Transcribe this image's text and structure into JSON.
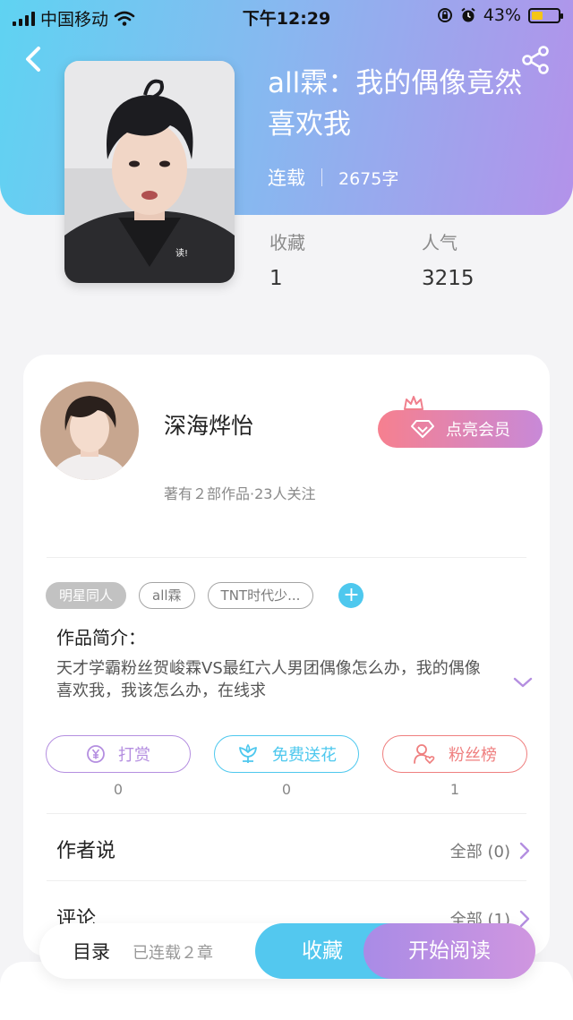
{
  "status_bar": {
    "carrier": "中国移动",
    "time": "下午12:29",
    "battery_text": "43%",
    "battery_level": 0.43
  },
  "colors": {
    "accent_blue": "#53c8ef",
    "accent_purple": "#b392ea",
    "vip_pink": "#f6808f",
    "reward_purple": "#b48ee0",
    "flower_blue": "#4ec8ee",
    "fans_red": "#ef7f7f"
  },
  "book": {
    "title": "all霖：我的偶像竟然喜欢我",
    "status": "连载",
    "word_count": "2675字",
    "stats": [
      {
        "label": "收藏",
        "value": "1"
      },
      {
        "label": "人气",
        "value": "3215"
      }
    ]
  },
  "author": {
    "name": "深海烨怡",
    "subline": "著有２部作品·23人关注",
    "vip_label": "点亮会员"
  },
  "tags": [
    "明星同人",
    "all霖",
    "TNT时代少..."
  ],
  "intro": {
    "heading": "作品简介：",
    "text": "天才学霸粉丝贺峻霖VS最红六人男团偶像怎么办，我的偶像喜欢我，我该怎么办，在线求"
  },
  "actions": [
    {
      "label": "打赏",
      "count": "0",
      "icon": "yen-coin-icon"
    },
    {
      "label": "免费送花",
      "count": "0",
      "icon": "flower-icon"
    },
    {
      "label": "粉丝榜",
      "count": "1",
      "icon": "fan-user-icon"
    }
  ],
  "rows": {
    "author_says": {
      "label": "作者说",
      "right": "全部 (0)"
    },
    "comments": {
      "label": "评论",
      "right": "全部 (1)"
    }
  },
  "bottom_bar": {
    "toc": "目录",
    "toc_status": "已连载２章",
    "favorite": "收藏",
    "start_reading": "开始阅读"
  }
}
